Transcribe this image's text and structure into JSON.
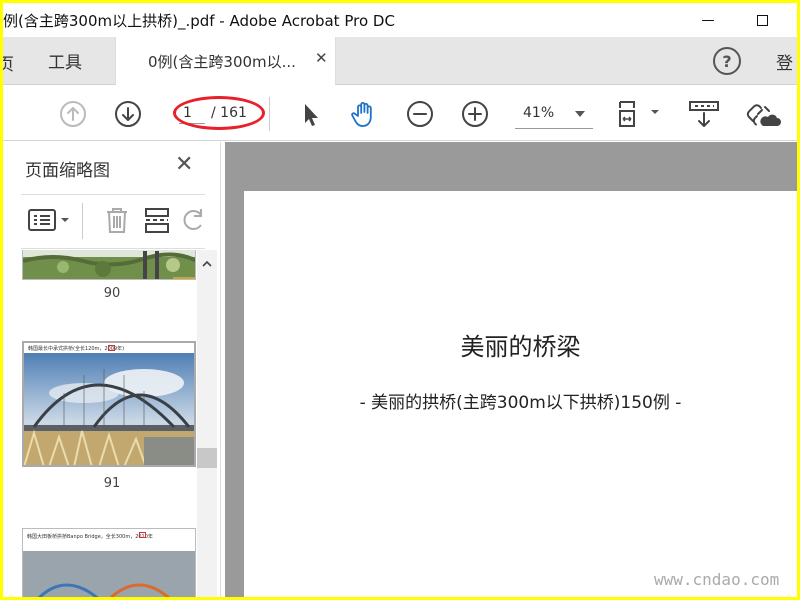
{
  "window": {
    "title": "例(含主跨300m以上拱桥)_.pdf - Adobe Acrobat Pro DC"
  },
  "tabs": {
    "home_partial": "页",
    "tools": "工具",
    "document": "0例(含主跨300m以...",
    "signin_partial": "登"
  },
  "toolbar": {
    "current_page": "1",
    "total_pages": "/ 161",
    "zoom": "41%"
  },
  "sidebar": {
    "title": "页面缩略图",
    "thumbnails": [
      {
        "label": "90",
        "caption": ""
      },
      {
        "label": "91",
        "caption": "韩国最长中承式拱桥(全长120m，2009年)"
      },
      {
        "label": "",
        "caption": "韩国大田板桥拱桥Banpo Bridge，全长300m，2010年"
      }
    ]
  },
  "page": {
    "heading": "美丽的桥梁",
    "subtitle": "- 美丽的拱桥(主跨300m以下拱桥)150例 -",
    "watermark": "www.cndao.com"
  },
  "colors": {
    "frame_border": "#ffff00",
    "highlight_ellipse": "#e8202a",
    "hand_tool_active": "#1e73c8",
    "doc_background": "#9a9a9a"
  }
}
